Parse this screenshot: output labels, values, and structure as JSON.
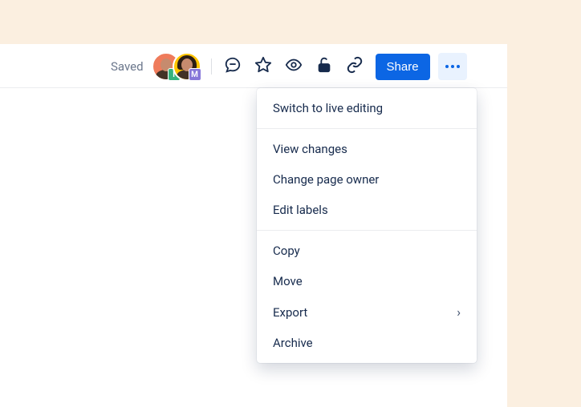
{
  "toolbar": {
    "saved_label": "Saved",
    "share_label": "Share",
    "avatars": [
      {
        "initial": "I",
        "badge_color": "#36B37E"
      },
      {
        "initial": "M",
        "badge_color": "#8777D9"
      }
    ]
  },
  "menu": {
    "sections": [
      [
        {
          "label": "Switch to live editing",
          "has_submenu": false
        }
      ],
      [
        {
          "label": "View changes",
          "has_submenu": false
        },
        {
          "label": "Change page owner",
          "has_submenu": false
        },
        {
          "label": "Edit labels",
          "has_submenu": false
        }
      ],
      [
        {
          "label": "Copy",
          "has_submenu": false
        },
        {
          "label": "Move",
          "has_submenu": false
        },
        {
          "label": "Export",
          "has_submenu": true
        },
        {
          "label": "Archive",
          "has_submenu": false
        }
      ]
    ]
  }
}
